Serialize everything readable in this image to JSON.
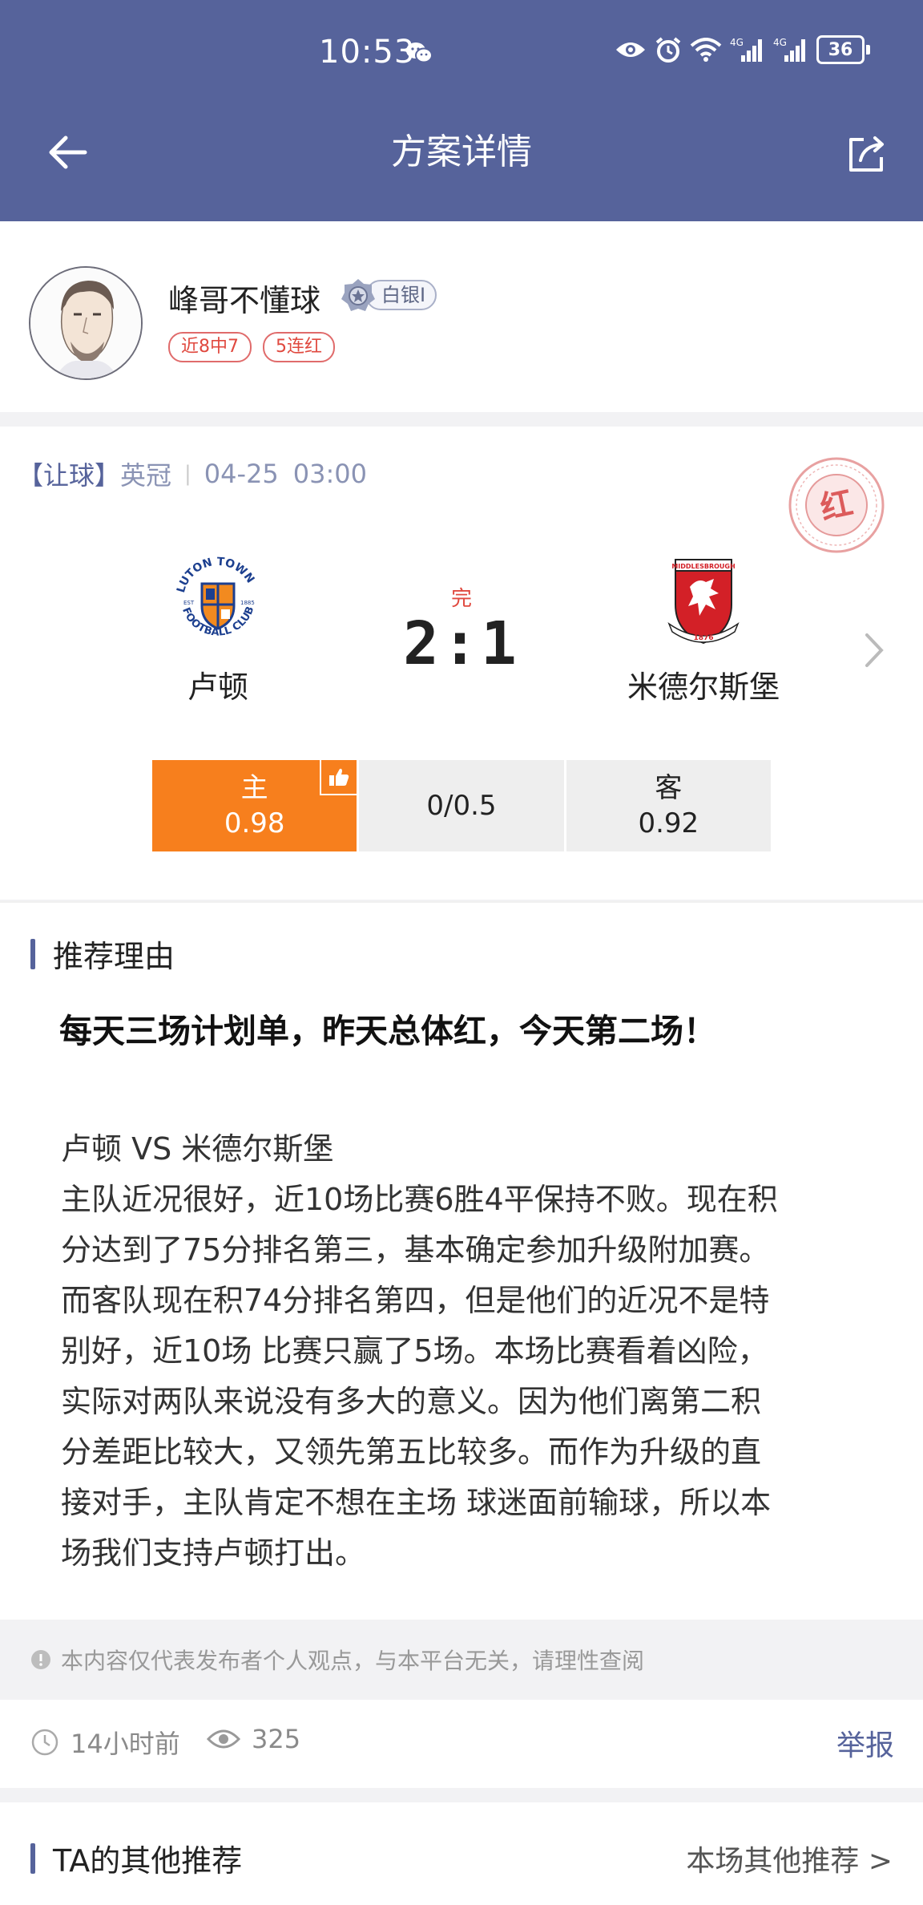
{
  "status_bar": {
    "time": "10:53",
    "battery": "36",
    "network_1": "4G",
    "network_2": "4G"
  },
  "nav": {
    "title": "方案详情"
  },
  "author": {
    "name": "峰哥不懂球",
    "level": "白银I",
    "tags": [
      "近8中7",
      "5连红"
    ]
  },
  "match": {
    "type": "【让球】",
    "league": "英冠",
    "date": "04-25",
    "time": "03:00",
    "stamp": "红",
    "status": "完",
    "score": "2:1",
    "home": {
      "name": "卢顿",
      "logo": "luton-town-crest"
    },
    "away": {
      "name": "米德尔斯堡",
      "logo": "middlesbrough-crest"
    }
  },
  "odds": {
    "home_label": "主",
    "home_value": "0.98",
    "handicap": "0/0.5",
    "away_label": "客",
    "away_value": "0.92",
    "selected": "home",
    "accent": "#f77f1d"
  },
  "reason": {
    "section_title": "推荐理由",
    "headline": "每天三场计划单，昨天总体红，今天第二场！",
    "lines": [
      "卢顿 VS 米德尔斯堡",
      "主队近况很好，近10场比赛6胜4平保持不败。现在积",
      "分达到了75分排名第三，基本确定参加升级附加赛。",
      "而客队现在积74分排名第四，但是他们的近况不是特",
      "别好，近10场 比赛只赢了5场。本场比赛看着凶险，",
      "实际对两队来说没有多大的意义。因为他们离第二积",
      "分差距比较大，又领先第五比较多。而作为升级的直",
      "接对手，主队肯定不想在主场 球迷面前输球，所以本",
      "场我们支持卢顿打出。"
    ]
  },
  "disclaimer": "本内容仅代表发布者个人观点，与本平台无关，请理性查阅",
  "stats": {
    "posted": "14小时前",
    "views": "325",
    "report": "举报"
  },
  "other": {
    "section_title": "TA的其他推荐",
    "link": "本场其他推荐 >"
  },
  "colors": {
    "header": "#56639b",
    "accent": "#f77f1d",
    "red": "#e0493f"
  }
}
